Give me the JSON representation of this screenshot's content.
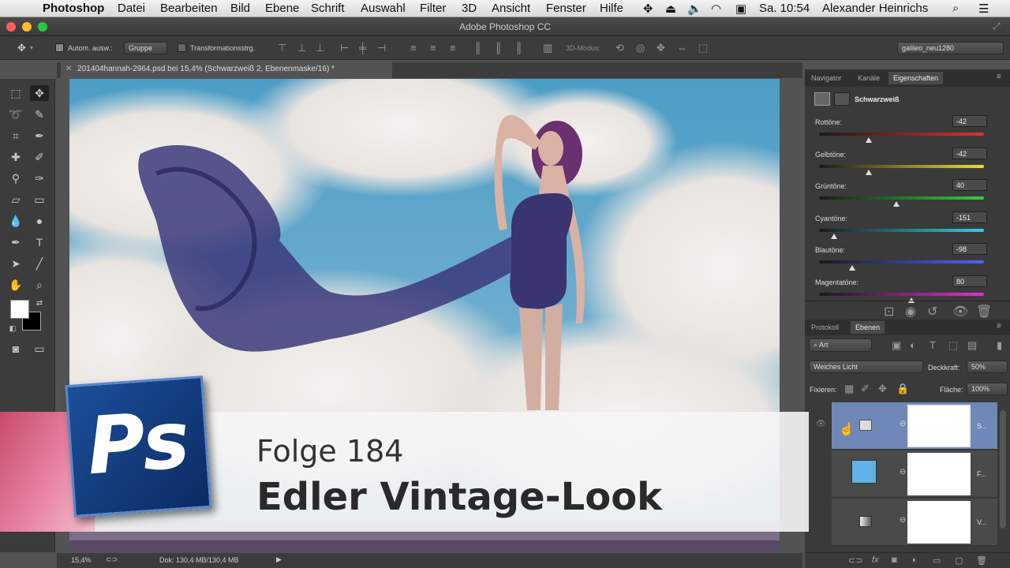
{
  "menubar": {
    "apple": "",
    "items": [
      "Photoshop",
      "Datei",
      "Bearbeiten",
      "Bild",
      "Ebene",
      "Schrift",
      "Auswahl",
      "Filter",
      "3D",
      "Ansicht",
      "Fenster",
      "Hilfe"
    ],
    "clock": "Sa. 10:54",
    "user": "Alexander Heinrichs"
  },
  "window": {
    "title": "Adobe Photoshop CC"
  },
  "options": {
    "auto_select_label": "Autom. ausw.:",
    "group_value": "Gruppe",
    "transform_label": "Transformationsstrg.",
    "mode3d_label": "3D-Modus:",
    "workspace": "galileo_neu1280"
  },
  "document": {
    "tab_title": "201404hannah-2964.psd bei 15,4% (Schwarzweiß 2, Ebenenmaske/16) *"
  },
  "status": {
    "zoom": "15,4%",
    "doc_info": "Dok: 130,4 MB/130,4 MB"
  },
  "properties": {
    "tabs": [
      "Navigator",
      "Kanäle",
      "Eigenschaften"
    ],
    "adjustment": "Schwarzweiß",
    "sliders": [
      {
        "label": "Rottöne:",
        "value": "-42",
        "pos": 0.3,
        "colors": [
          "#1a1a1a",
          "#e03030"
        ]
      },
      {
        "label": "Gelbtöne:",
        "value": "-42",
        "pos": 0.3,
        "colors": [
          "#1a1a1a",
          "#e8e030"
        ]
      },
      {
        "label": "Grüntöne:",
        "value": "40",
        "pos": 0.47,
        "colors": [
          "#1a1a1a",
          "#30d040"
        ]
      },
      {
        "label": "Cyantöne:",
        "value": "-151",
        "pos": 0.09,
        "colors": [
          "#1a1a1a",
          "#30d0e0"
        ]
      },
      {
        "label": "Blautöne:",
        "value": "-98",
        "pos": 0.2,
        "colors": [
          "#1a1a1a",
          "#5060ff"
        ]
      },
      {
        "label": "Magentatöne:",
        "value": "80",
        "pos": 0.56,
        "colors": [
          "#1a1a1a",
          "#e030d0"
        ]
      }
    ]
  },
  "layers": {
    "tabs": [
      "Protokoll",
      "Ebenen"
    ],
    "filter": "Art",
    "blend_mode": "Weiches Licht",
    "opacity_label": "Deckkraft:",
    "opacity": "50%",
    "lock_label": "Fixieren:",
    "fill_label": "Fläche:",
    "fill": "100%",
    "rows": [
      {
        "name": "S..."
      },
      {
        "name": "F..."
      },
      {
        "name": "V..."
      }
    ]
  },
  "banner": {
    "episode": "Folge 184",
    "title": "Edler Vintage-Look",
    "logo": "Ps"
  }
}
